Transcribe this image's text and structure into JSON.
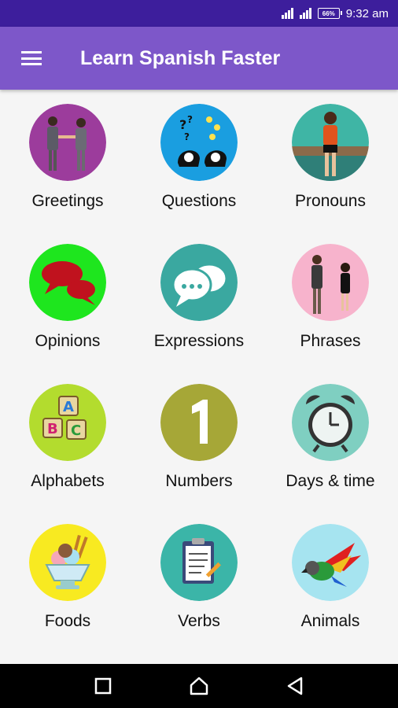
{
  "status_bar": {
    "battery": "66%",
    "time": "9:32 am"
  },
  "app_bar": {
    "title": "Learn Spanish Faster"
  },
  "categories": [
    {
      "label": "Greetings",
      "icon": "handshake-icon",
      "bg": "#9c3c9c"
    },
    {
      "label": "Questions",
      "icon": "question-heads-icon",
      "bg": "#1a9ee0"
    },
    {
      "label": "Pronouns",
      "icon": "woman-sitting-icon",
      "bg": "#3fb5a5"
    },
    {
      "label": "Opinions",
      "icon": "speech-bubbles-icon",
      "bg": "#1ee61e"
    },
    {
      "label": "Expressions",
      "icon": "chat-bubbles-icon",
      "bg": "#3aa8a0"
    },
    {
      "label": "Phrases",
      "icon": "talking-couple-icon",
      "bg": "#f7b3cc"
    },
    {
      "label": "Alphabets",
      "icon": "abc-blocks-icon",
      "bg": "#b3dc2e"
    },
    {
      "label": "Numbers",
      "icon": "number-one-icon",
      "bg": "#a6a737"
    },
    {
      "label": "Days & time",
      "icon": "alarm-clock-icon",
      "bg": "#7fcfc1"
    },
    {
      "label": "Foods",
      "icon": "ice-cream-icon",
      "bg": "#f8ea21"
    },
    {
      "label": "Verbs",
      "icon": "clipboard-icon",
      "bg": "#3bb5a8"
    },
    {
      "label": "Animals",
      "icon": "parrot-icon",
      "bg": "#a6e4f0"
    }
  ],
  "nav": [
    "recents-button",
    "home-button",
    "back-button"
  ]
}
